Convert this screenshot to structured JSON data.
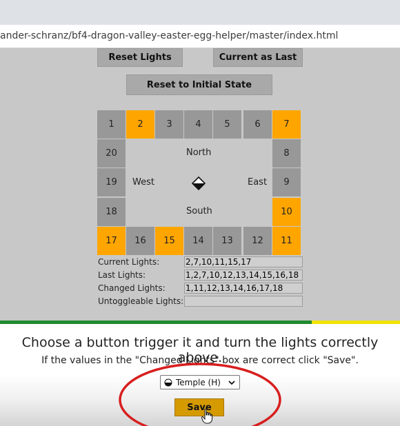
{
  "browser": {
    "url": "ander-schranz/bf4-dragon-valley-easter-egg-helper/master/index.html"
  },
  "buttons": {
    "reset_lights": "Reset Lights",
    "current_as_last": "Current as Last",
    "reset_initial": "Reset to Initial State"
  },
  "grid": {
    "cells": [
      {
        "label": "1",
        "on": false
      },
      {
        "label": "2",
        "on": true
      },
      {
        "label": "3",
        "on": false
      },
      {
        "label": "4",
        "on": false
      },
      {
        "label": "5",
        "on": false
      },
      {
        "label": "6",
        "on": false
      },
      {
        "label": "7",
        "on": true
      },
      {
        "label": "8",
        "on": false
      },
      {
        "label": "9",
        "on": false
      },
      {
        "label": "10",
        "on": true
      },
      {
        "label": "11",
        "on": true
      },
      {
        "label": "12",
        "on": false
      },
      {
        "label": "13",
        "on": false
      },
      {
        "label": "14",
        "on": false
      },
      {
        "label": "15",
        "on": true
      },
      {
        "label": "16",
        "on": false
      },
      {
        "label": "17",
        "on": true
      },
      {
        "label": "18",
        "on": false
      },
      {
        "label": "19",
        "on": false
      },
      {
        "label": "20",
        "on": false
      }
    ],
    "north": "North",
    "south": "South",
    "west": "West",
    "east": "East",
    "center_icon": "compass-diamond-icon"
  },
  "info": {
    "current_label": "Current Lights:",
    "current_value": "2,7,10,11,15,17",
    "last_label": "Last Lights:",
    "last_value": "1,2,7,10,12,13,14,15,16,18",
    "changed_label": "Changed Lights:",
    "changed_value": "1,11,12,13,14,16,17,18",
    "untoggleable_label": "Untoggleable Lights:",
    "untoggleable_value": ""
  },
  "overlay": {
    "line1": "Choose a button trigger it and turn the lights correctly above.",
    "line2": "If the values in the \"Changed Lights\" box are correct click \"Save\".",
    "select_value": "Temple (H)",
    "select_icon": "half-circle-icon",
    "save_label": "Save"
  },
  "colors": {
    "light_on": "#ffa500",
    "light_off": "#989898",
    "save_button": "#d59a00",
    "annotation_circle": "#d81e1e",
    "stripe_green": "#1f8a2e",
    "stripe_yellow": "#f0e300"
  }
}
